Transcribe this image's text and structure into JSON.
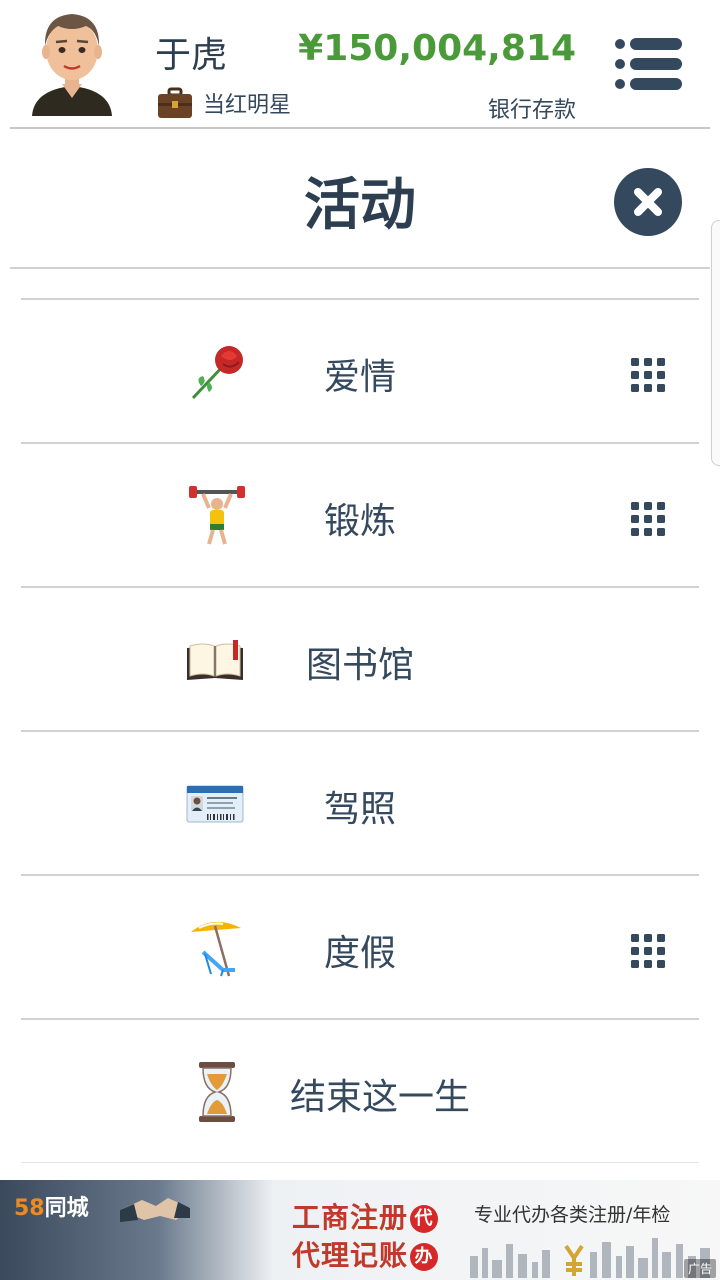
{
  "player": {
    "name": "于虎",
    "job": "当红明星",
    "money": "¥150,004,814",
    "money_label": "银行存款"
  },
  "panel": {
    "title": "活动"
  },
  "activities": [
    {
      "label": "爱情",
      "icon": "rose-icon",
      "has_options": true
    },
    {
      "label": "锻炼",
      "icon": "weightlifter-icon",
      "has_options": true
    },
    {
      "label": "图书馆",
      "icon": "open-book-icon",
      "has_options": false
    },
    {
      "label": "驾照",
      "icon": "driver-license-icon",
      "has_options": false
    },
    {
      "label": "度假",
      "icon": "beach-umbrella-icon",
      "has_options": true
    },
    {
      "label": "结束这一生",
      "icon": "hourglass-icon",
      "has_options": false
    }
  ],
  "ad": {
    "brand_number": "58",
    "brand_name": "同城",
    "line1": "工商注册",
    "badge1": "代",
    "line2": "代理记账",
    "badge2": "办",
    "slogan": "专业代办各类注册/年检",
    "tag": "广告"
  },
  "colors": {
    "text": "#34495e",
    "money": "#4a9a3a",
    "close_button": "#34495e",
    "divider": "#d2d2d2",
    "ad_red": "#c0392b"
  }
}
